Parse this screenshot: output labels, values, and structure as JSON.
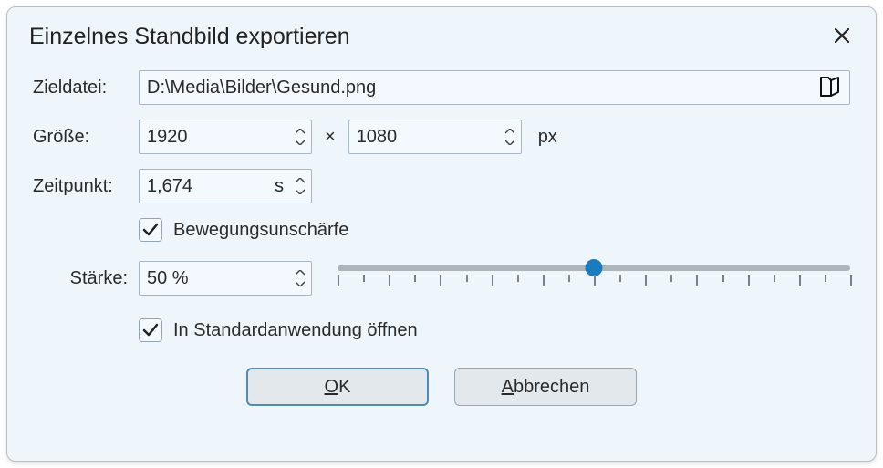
{
  "dialog": {
    "title": "Einzelnes Standbild exportieren",
    "labels": {
      "targetFile": "Zieldatei:",
      "size": "Größe:",
      "timestamp": "Zeitpunkt:",
      "strength": "Stärke:"
    },
    "targetFile": "D:\\Media\\Bilder\\Gesund.png",
    "size": {
      "width": "1920",
      "height": "1080",
      "unit": "px",
      "mult": "×"
    },
    "timestamp": {
      "value": "1,674",
      "unit": "s"
    },
    "motionBlur": {
      "checked": true,
      "label": "Bewegungsunschärfe"
    },
    "strength": {
      "text": "50 %",
      "percent": 50
    },
    "openDefault": {
      "checked": true,
      "label": "In Standardanwendung öffnen"
    },
    "buttons": {
      "ok_pre": "",
      "ok_mn": "O",
      "ok_post": "K",
      "cancel_pre": "",
      "cancel_mn": "A",
      "cancel_post": "bbrechen"
    }
  }
}
